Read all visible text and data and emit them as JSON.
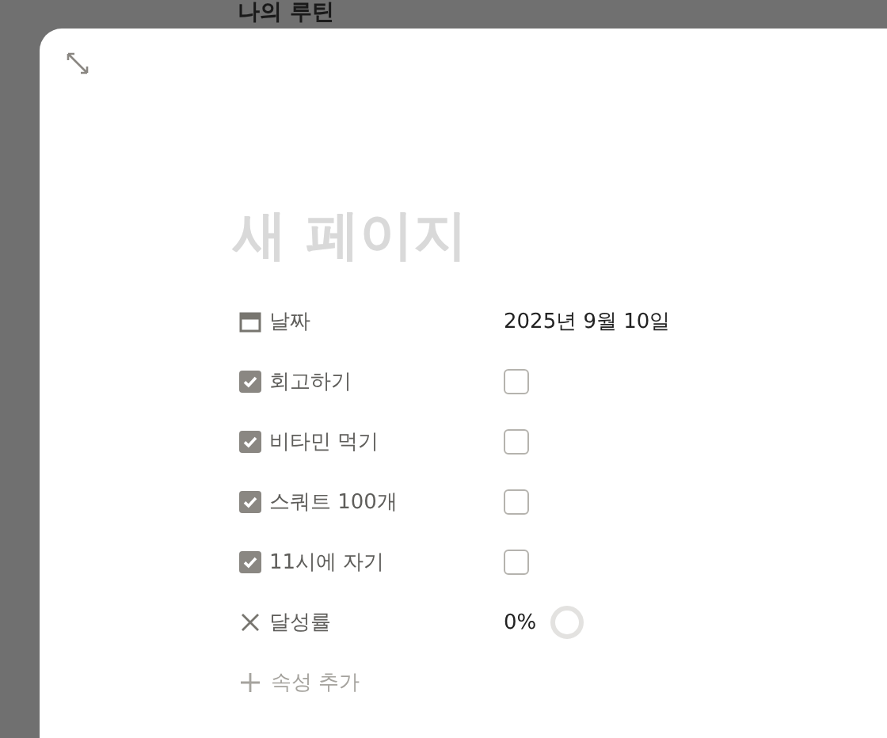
{
  "background_page": {
    "title": "나의 루틴"
  },
  "modal": {
    "title": {
      "placeholder": "새 페이지"
    },
    "properties": [
      {
        "kind": "date",
        "label": "날짜",
        "value": "2025년 9월 10일"
      },
      {
        "kind": "checkbox",
        "label": "회고하기",
        "checked": false
      },
      {
        "kind": "checkbox",
        "label": "비타민 먹기",
        "checked": false
      },
      {
        "kind": "checkbox",
        "label": "스쿼트 100개",
        "checked": false
      },
      {
        "kind": "checkbox",
        "label": "11시에 자기",
        "checked": false
      },
      {
        "kind": "formula",
        "label": "달성률",
        "value": "0%"
      }
    ],
    "add_property": "속성 추가"
  }
}
